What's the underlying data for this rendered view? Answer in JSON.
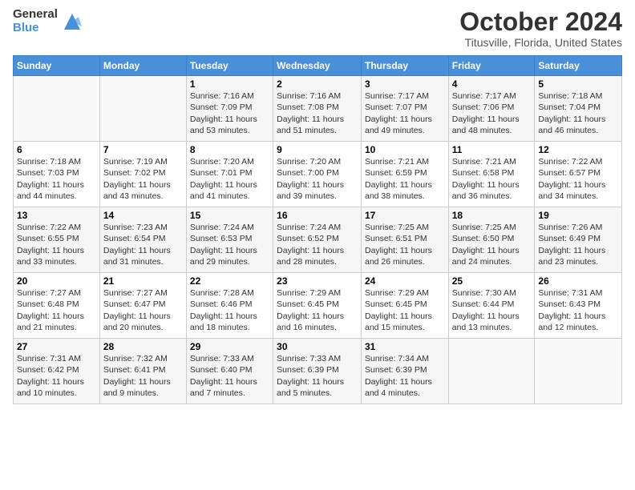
{
  "logo": {
    "general": "General",
    "blue": "Blue"
  },
  "title": "October 2024",
  "location": "Titusville, Florida, United States",
  "days_of_week": [
    "Sunday",
    "Monday",
    "Tuesday",
    "Wednesday",
    "Thursday",
    "Friday",
    "Saturday"
  ],
  "weeks": [
    [
      {
        "day": "",
        "sunrise": "",
        "sunset": "",
        "daylight": ""
      },
      {
        "day": "",
        "sunrise": "",
        "sunset": "",
        "daylight": ""
      },
      {
        "day": "1",
        "sunrise": "Sunrise: 7:16 AM",
        "sunset": "Sunset: 7:09 PM",
        "daylight": "Daylight: 11 hours and 53 minutes."
      },
      {
        "day": "2",
        "sunrise": "Sunrise: 7:16 AM",
        "sunset": "Sunset: 7:08 PM",
        "daylight": "Daylight: 11 hours and 51 minutes."
      },
      {
        "day": "3",
        "sunrise": "Sunrise: 7:17 AM",
        "sunset": "Sunset: 7:07 PM",
        "daylight": "Daylight: 11 hours and 49 minutes."
      },
      {
        "day": "4",
        "sunrise": "Sunrise: 7:17 AM",
        "sunset": "Sunset: 7:06 PM",
        "daylight": "Daylight: 11 hours and 48 minutes."
      },
      {
        "day": "5",
        "sunrise": "Sunrise: 7:18 AM",
        "sunset": "Sunset: 7:04 PM",
        "daylight": "Daylight: 11 hours and 46 minutes."
      }
    ],
    [
      {
        "day": "6",
        "sunrise": "Sunrise: 7:18 AM",
        "sunset": "Sunset: 7:03 PM",
        "daylight": "Daylight: 11 hours and 44 minutes."
      },
      {
        "day": "7",
        "sunrise": "Sunrise: 7:19 AM",
        "sunset": "Sunset: 7:02 PM",
        "daylight": "Daylight: 11 hours and 43 minutes."
      },
      {
        "day": "8",
        "sunrise": "Sunrise: 7:20 AM",
        "sunset": "Sunset: 7:01 PM",
        "daylight": "Daylight: 11 hours and 41 minutes."
      },
      {
        "day": "9",
        "sunrise": "Sunrise: 7:20 AM",
        "sunset": "Sunset: 7:00 PM",
        "daylight": "Daylight: 11 hours and 39 minutes."
      },
      {
        "day": "10",
        "sunrise": "Sunrise: 7:21 AM",
        "sunset": "Sunset: 6:59 PM",
        "daylight": "Daylight: 11 hours and 38 minutes."
      },
      {
        "day": "11",
        "sunrise": "Sunrise: 7:21 AM",
        "sunset": "Sunset: 6:58 PM",
        "daylight": "Daylight: 11 hours and 36 minutes."
      },
      {
        "day": "12",
        "sunrise": "Sunrise: 7:22 AM",
        "sunset": "Sunset: 6:57 PM",
        "daylight": "Daylight: 11 hours and 34 minutes."
      }
    ],
    [
      {
        "day": "13",
        "sunrise": "Sunrise: 7:22 AM",
        "sunset": "Sunset: 6:55 PM",
        "daylight": "Daylight: 11 hours and 33 minutes."
      },
      {
        "day": "14",
        "sunrise": "Sunrise: 7:23 AM",
        "sunset": "Sunset: 6:54 PM",
        "daylight": "Daylight: 11 hours and 31 minutes."
      },
      {
        "day": "15",
        "sunrise": "Sunrise: 7:24 AM",
        "sunset": "Sunset: 6:53 PM",
        "daylight": "Daylight: 11 hours and 29 minutes."
      },
      {
        "day": "16",
        "sunrise": "Sunrise: 7:24 AM",
        "sunset": "Sunset: 6:52 PM",
        "daylight": "Daylight: 11 hours and 28 minutes."
      },
      {
        "day": "17",
        "sunrise": "Sunrise: 7:25 AM",
        "sunset": "Sunset: 6:51 PM",
        "daylight": "Daylight: 11 hours and 26 minutes."
      },
      {
        "day": "18",
        "sunrise": "Sunrise: 7:25 AM",
        "sunset": "Sunset: 6:50 PM",
        "daylight": "Daylight: 11 hours and 24 minutes."
      },
      {
        "day": "19",
        "sunrise": "Sunrise: 7:26 AM",
        "sunset": "Sunset: 6:49 PM",
        "daylight": "Daylight: 11 hours and 23 minutes."
      }
    ],
    [
      {
        "day": "20",
        "sunrise": "Sunrise: 7:27 AM",
        "sunset": "Sunset: 6:48 PM",
        "daylight": "Daylight: 11 hours and 21 minutes."
      },
      {
        "day": "21",
        "sunrise": "Sunrise: 7:27 AM",
        "sunset": "Sunset: 6:47 PM",
        "daylight": "Daylight: 11 hours and 20 minutes."
      },
      {
        "day": "22",
        "sunrise": "Sunrise: 7:28 AM",
        "sunset": "Sunset: 6:46 PM",
        "daylight": "Daylight: 11 hours and 18 minutes."
      },
      {
        "day": "23",
        "sunrise": "Sunrise: 7:29 AM",
        "sunset": "Sunset: 6:45 PM",
        "daylight": "Daylight: 11 hours and 16 minutes."
      },
      {
        "day": "24",
        "sunrise": "Sunrise: 7:29 AM",
        "sunset": "Sunset: 6:45 PM",
        "daylight": "Daylight: 11 hours and 15 minutes."
      },
      {
        "day": "25",
        "sunrise": "Sunrise: 7:30 AM",
        "sunset": "Sunset: 6:44 PM",
        "daylight": "Daylight: 11 hours and 13 minutes."
      },
      {
        "day": "26",
        "sunrise": "Sunrise: 7:31 AM",
        "sunset": "Sunset: 6:43 PM",
        "daylight": "Daylight: 11 hours and 12 minutes."
      }
    ],
    [
      {
        "day": "27",
        "sunrise": "Sunrise: 7:31 AM",
        "sunset": "Sunset: 6:42 PM",
        "daylight": "Daylight: 11 hours and 10 minutes."
      },
      {
        "day": "28",
        "sunrise": "Sunrise: 7:32 AM",
        "sunset": "Sunset: 6:41 PM",
        "daylight": "Daylight: 11 hours and 9 minutes."
      },
      {
        "day": "29",
        "sunrise": "Sunrise: 7:33 AM",
        "sunset": "Sunset: 6:40 PM",
        "daylight": "Daylight: 11 hours and 7 minutes."
      },
      {
        "day": "30",
        "sunrise": "Sunrise: 7:33 AM",
        "sunset": "Sunset: 6:39 PM",
        "daylight": "Daylight: 11 hours and 5 minutes."
      },
      {
        "day": "31",
        "sunrise": "Sunrise: 7:34 AM",
        "sunset": "Sunset: 6:39 PM",
        "daylight": "Daylight: 11 hours and 4 minutes."
      },
      {
        "day": "",
        "sunrise": "",
        "sunset": "",
        "daylight": ""
      },
      {
        "day": "",
        "sunrise": "",
        "sunset": "",
        "daylight": ""
      }
    ]
  ]
}
